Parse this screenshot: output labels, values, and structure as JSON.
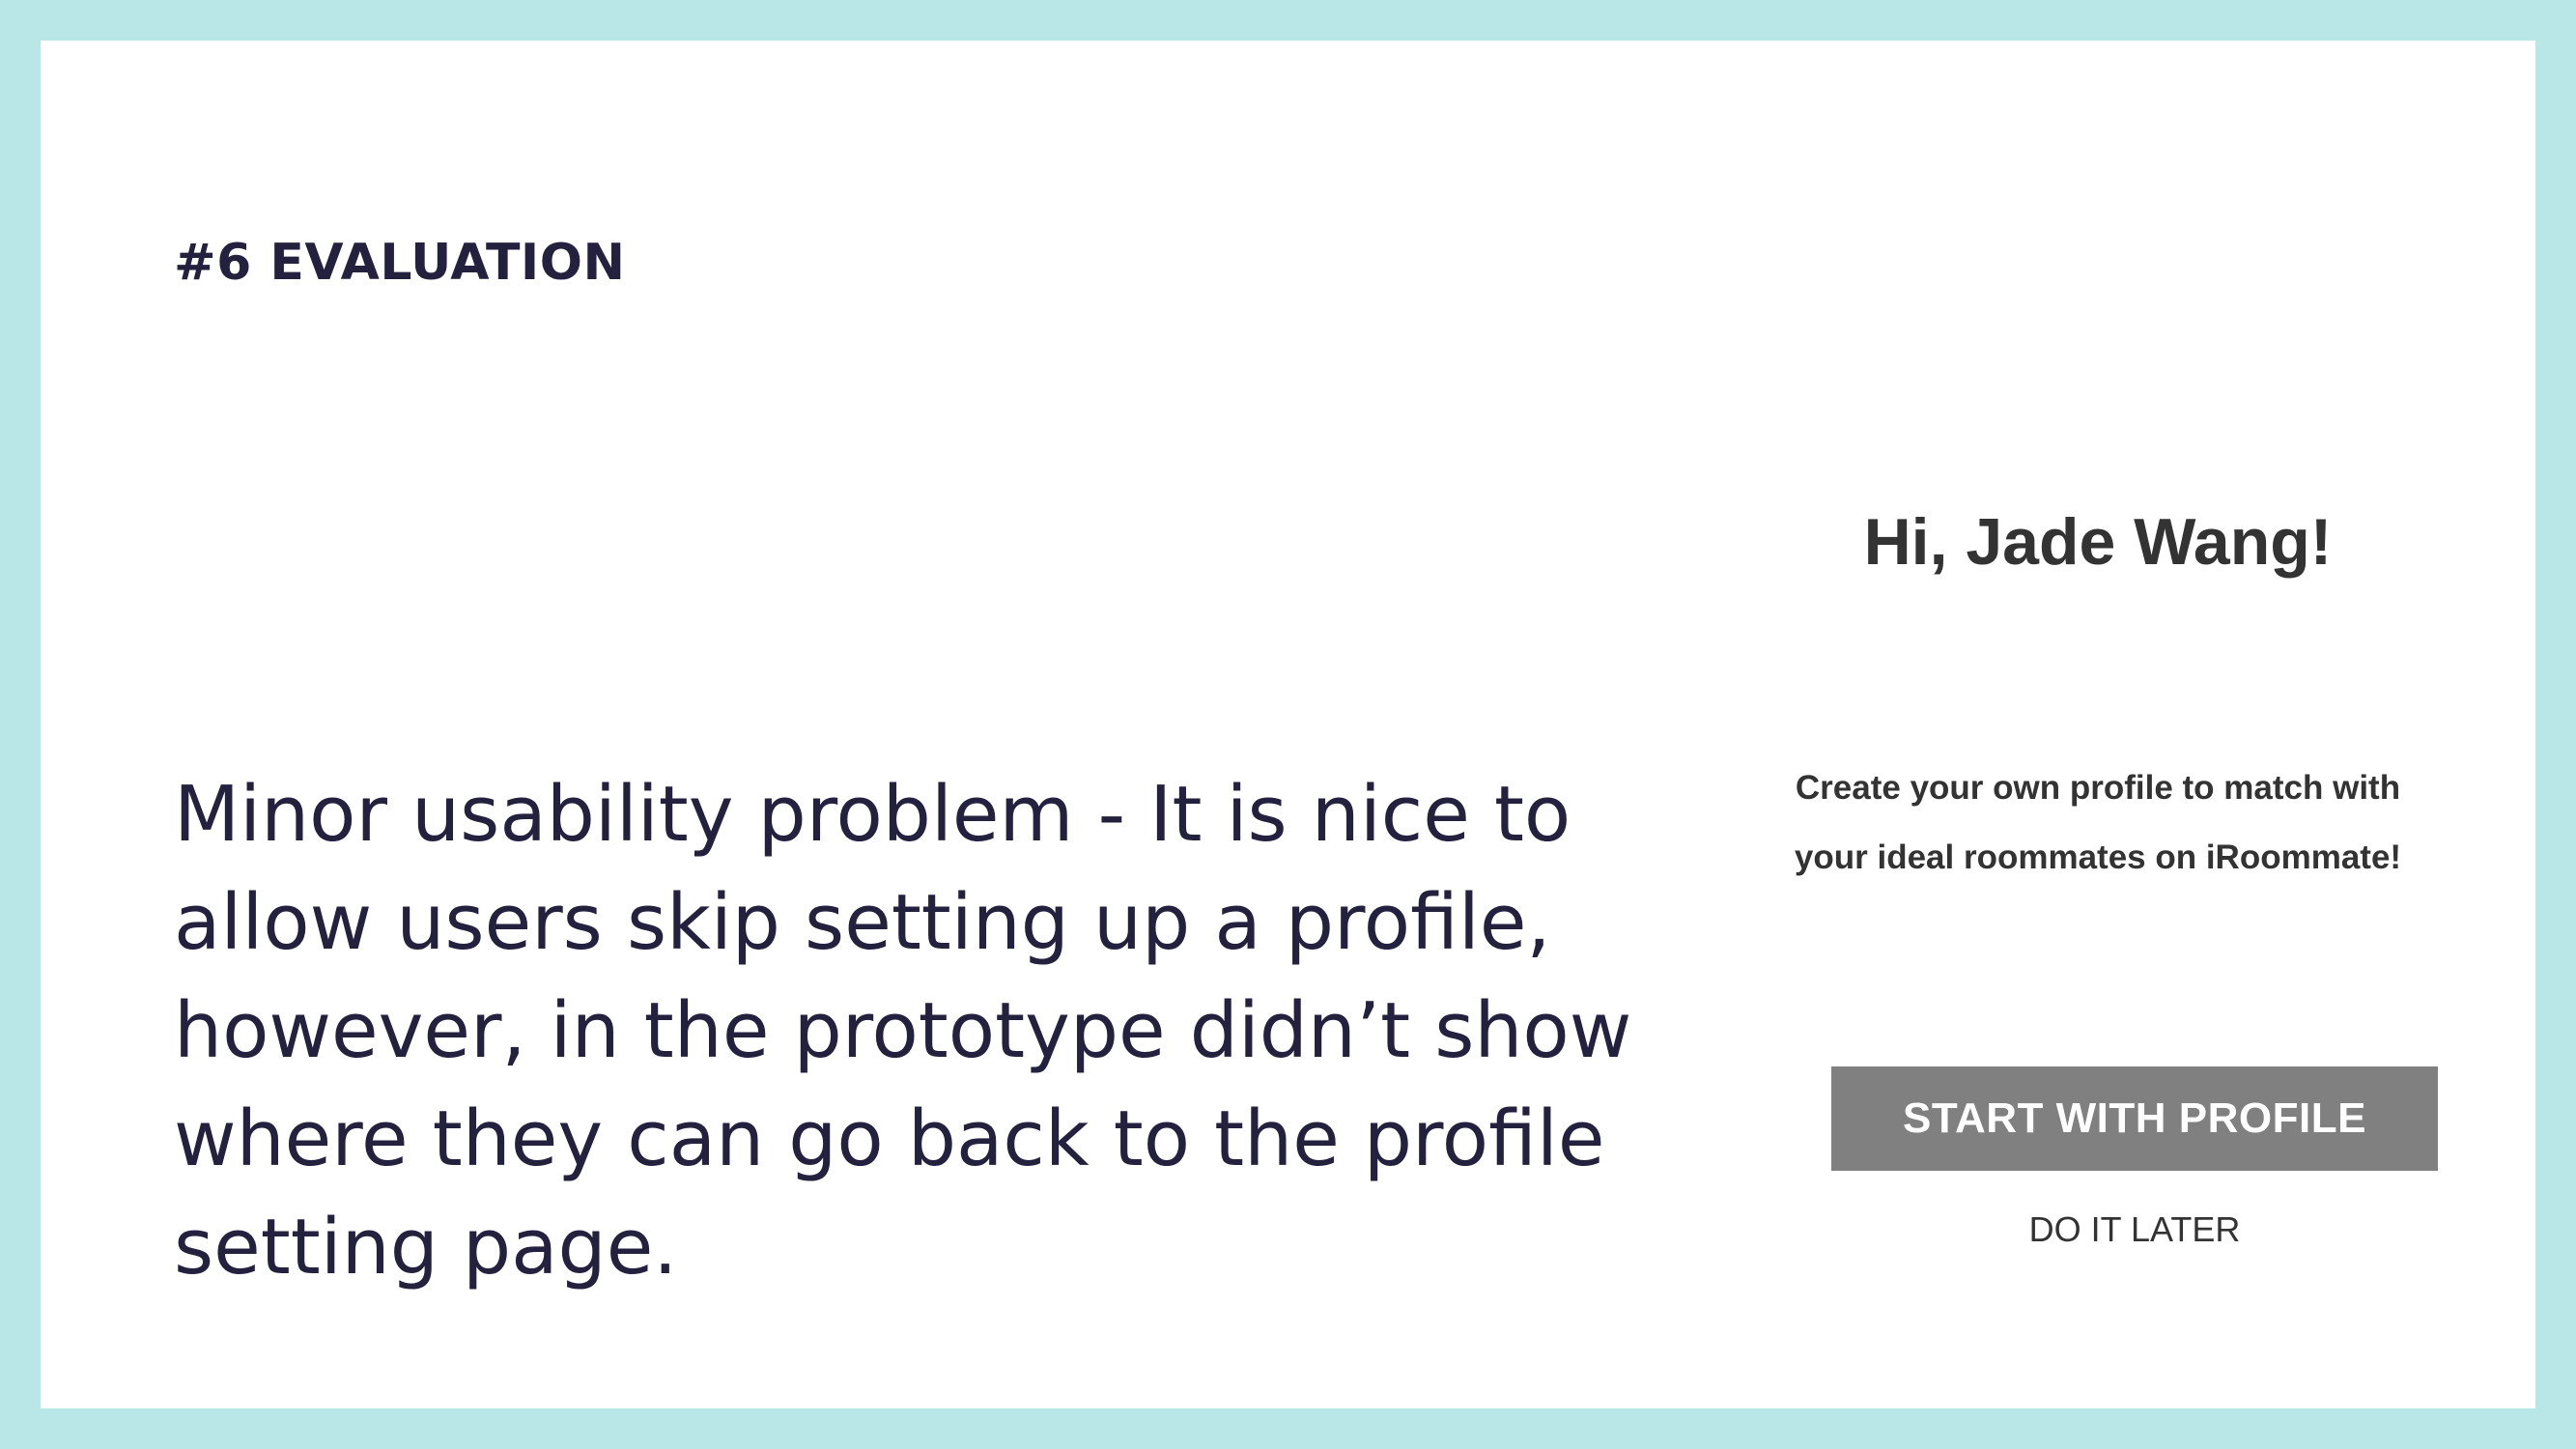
{
  "slide": {
    "section_label": "#6 EVALUATION",
    "body_text": "Minor usability problem - It is nice to allow users skip setting up a profile, however, in the prototype didn’t show where they can go back to the profile setting page."
  },
  "mockup": {
    "greeting": "Hi, Jade Wang!",
    "subtitle_line1": "Create your own profile to match with",
    "subtitle_line2": "your ideal roommates on iRoommate!",
    "primary_button_label": "START WITH PROFILE",
    "secondary_link_label": "DO IT LATER"
  },
  "colors": {
    "frame": "#b9e7e7",
    "heading_text": "#24213f",
    "button_fill": "#808080",
    "mockup_text": "#333333"
  }
}
